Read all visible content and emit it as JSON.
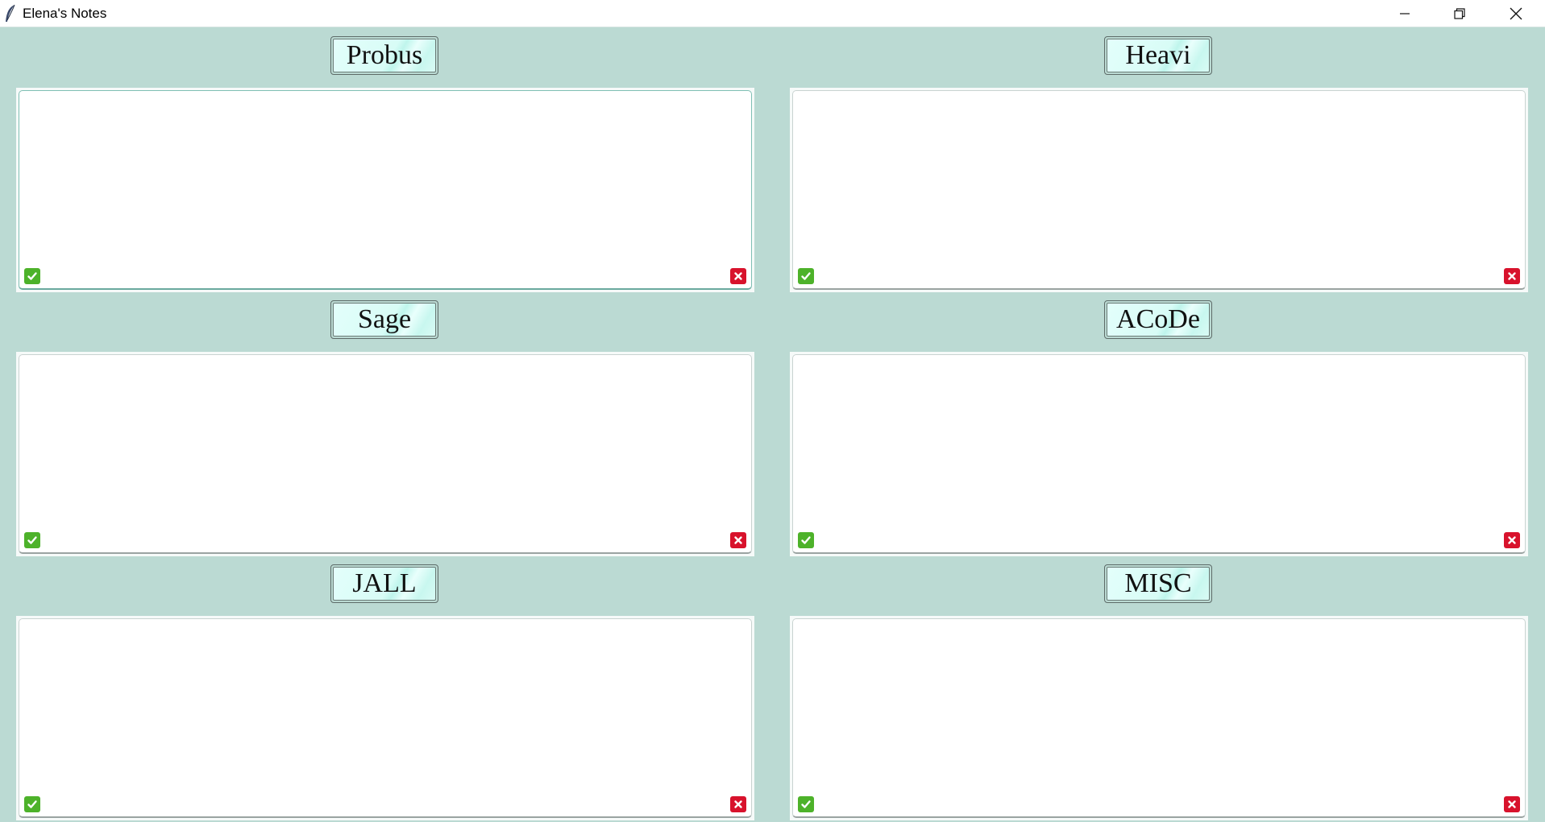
{
  "window": {
    "title": "Elena's Notes",
    "icon": "feather-icon"
  },
  "colors": {
    "background": "#bbdad3",
    "check": "#4db22a",
    "delete": "#d8122c"
  },
  "notes": [
    {
      "title": "Probus",
      "content": "",
      "focused": true
    },
    {
      "title": "Heavi",
      "content": "",
      "focused": false
    },
    {
      "title": "Sage",
      "content": "",
      "focused": false
    },
    {
      "title": "ACoDe",
      "content": "",
      "focused": false
    },
    {
      "title": "JALL",
      "content": "",
      "focused": false
    },
    {
      "title": "MISC",
      "content": "",
      "focused": false
    }
  ]
}
